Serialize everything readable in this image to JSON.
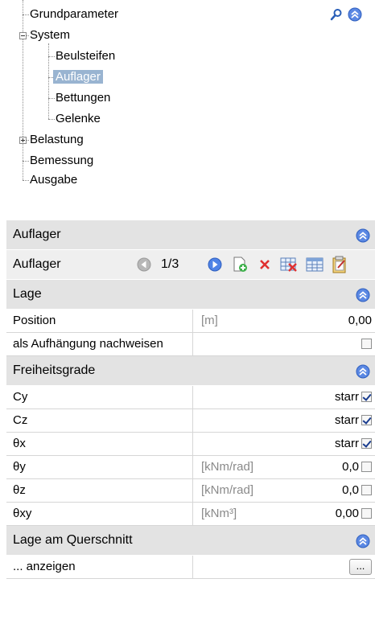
{
  "tree": {
    "items": [
      {
        "label": "Grundparameter"
      },
      {
        "label": "System"
      },
      {
        "label": "Beulsteifen"
      },
      {
        "label": "Auflager"
      },
      {
        "label": "Bettungen"
      },
      {
        "label": "Gelenke"
      },
      {
        "label": "Belastung"
      },
      {
        "label": "Bemessung"
      },
      {
        "label": "Ausgabe"
      }
    ],
    "selected": "Auflager"
  },
  "panel": {
    "title": "Auflager",
    "nav": {
      "label": "Auflager",
      "page": "1/3"
    },
    "sections": [
      {
        "title": "Lage",
        "rows": [
          {
            "name": "Position",
            "unit": "[m]",
            "value": "0,00"
          },
          {
            "name": "als Aufhängung nachweisen",
            "unit": "",
            "value": "",
            "checked": false
          }
        ]
      },
      {
        "title": "Freiheitsgrade",
        "rows": [
          {
            "name": "Cy",
            "unit": "",
            "value": "starr",
            "checked": true
          },
          {
            "name": "Cz",
            "unit": "",
            "value": "starr",
            "checked": true
          },
          {
            "name": "θx",
            "unit": "",
            "value": "starr",
            "checked": true
          },
          {
            "name": "θy",
            "unit": "[kNm/rad]",
            "value": "0,0",
            "checked": false
          },
          {
            "name": "θz",
            "unit": "[kNm/rad]",
            "value": "0,0",
            "checked": false
          },
          {
            "name": "θxy",
            "unit": "[kNm³]",
            "value": "0,00",
            "checked": false
          }
        ]
      },
      {
        "title": "Lage am Querschnitt",
        "rows": [
          {
            "name": "... anzeigen",
            "button": "..."
          }
        ]
      }
    ]
  },
  "colors": {
    "header_bg": "#e3e3e3",
    "selection": "#99b4d1",
    "accent_blue": "#3a6fd8"
  }
}
